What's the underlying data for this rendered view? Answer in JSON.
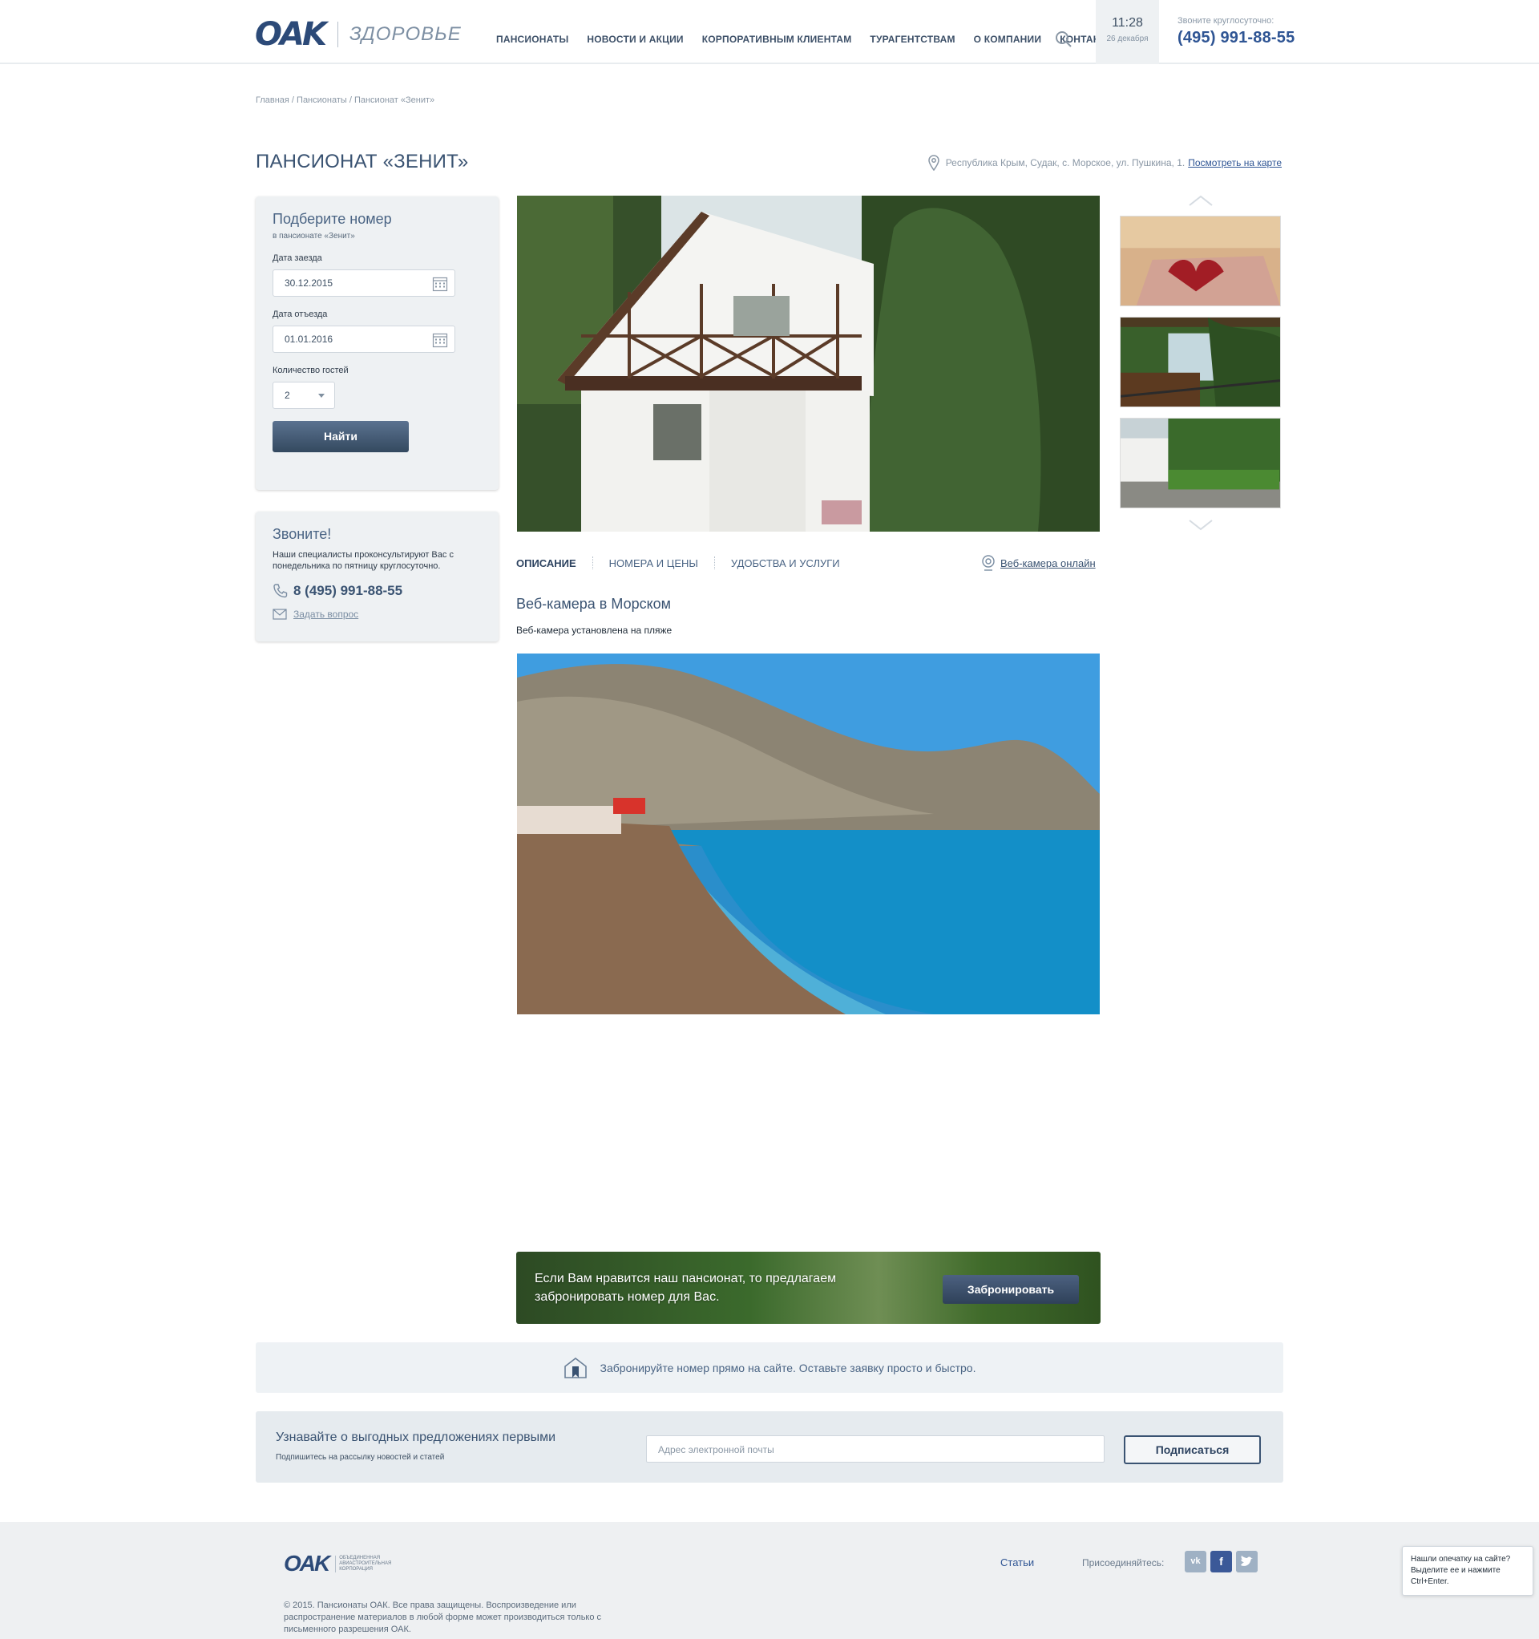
{
  "header": {
    "logo_main": "OAK",
    "logo_sub": "ЗДОРОВЬЕ",
    "nav": [
      "ПАНСИОНАТЫ",
      "НОВОСТИ И АКЦИИ",
      "КОРПОРАТИВНЫМ КЛИЕНТАМ",
      "ТУРАГЕНТСТВАМ",
      "О КОМПАНИИ",
      "КОНТАКТЫ"
    ],
    "time": "11:28",
    "date": "26 декабря",
    "phone_caption": "Звоните круглосуточно:",
    "phone": "(495) 991-88-55"
  },
  "breadcrumb": "Главная / Пансионаты / Пансионат «Зенит»",
  "title": "ПАНСИОНАТ «ЗЕНИТ»",
  "address": {
    "text": "Республика Крым, Судак, с. Морское, ул. Пушкина, 1.",
    "map_link": "Посмотреть на карте"
  },
  "booking": {
    "title": "Подберите номер",
    "subtitle": "в пансионате «Зенит»",
    "checkin_label": "Дата заезда",
    "checkin_value": "30.12.2015",
    "checkout_label": "Дата отъезда",
    "checkout_value": "01.01.2016",
    "guests_label": "Количество гостей",
    "guests_value": "2",
    "find_button": "Найти"
  },
  "call": {
    "title": "Звоните!",
    "text": "Наши специалисты проконсультируют Вас с понедельника по пятницу круглосуточно.",
    "phone": "8 (495) 991-88-55",
    "ask": "Задать вопрос"
  },
  "tabs": [
    "ОПИСАНИЕ",
    "НОМЕРА И ЦЕНЫ",
    "УДОБСТВА И УСЛУГИ"
  ],
  "webcam_link": "Веб-камера онлайн",
  "section": {
    "title": "Веб-камера в Морском",
    "text": "Веб-камера установлена на пляже"
  },
  "cta": {
    "text": "Если Вам нравится наш пансионат, то предлагаем забронировать номер для Вас.",
    "button": "Забронировать"
  },
  "info_bar": "Забронируйте номер прямо на сайте. Оставьте заявку просто и быстро.",
  "subscribe": {
    "title": "Узнавайте о выгодных предложениях первыми",
    "text": "Подпишитесь на рассылку новостей и статей",
    "placeholder": "Адрес электронной почты",
    "button": "Подписаться"
  },
  "footer": {
    "logo": "OAK",
    "corp": "ОБЪЕДИНЕННАЯ АВИАСТРОИТЕЛЬНАЯ КОРПОРАЦИЯ",
    "copyright": "© 2015. Пансионаты ОАК. Все права защищены. Воспроизведение или распространение материалов в любой форме может производиться только с письменного разрешения ОАК.",
    "link": "Статьи",
    "join": "Присоединяйтесь:"
  },
  "typo_notice": "Нашли опечатку на сайте? Выделите ее и нажмите Ctrl+Enter."
}
